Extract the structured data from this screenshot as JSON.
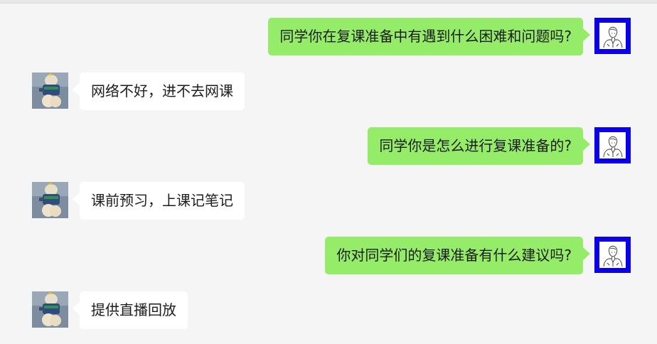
{
  "chat": {
    "messages": [
      {
        "sender": "teacher",
        "text": "同学你在复课准备中有遇到什么困难和问题吗?"
      },
      {
        "sender": "student",
        "text": "网络不好，进不去网课"
      },
      {
        "sender": "teacher",
        "text": "同学你是怎么进行复课准备的?"
      },
      {
        "sender": "student",
        "text": "课前预习，上课记笔记"
      },
      {
        "sender": "teacher",
        "text": "你对同学们的复课准备有什么建议吗?"
      },
      {
        "sender": "student",
        "text": "提供直播回放"
      }
    ]
  },
  "colors": {
    "background": "#f5f5f5",
    "sent_bubble": "#95ec69",
    "received_bubble": "#ffffff",
    "teacher_avatar_frame": "#0a00ea"
  },
  "icons": {
    "teacher_avatar": "line-drawing-person-avatar",
    "student_avatar": "toy-figure-photo-avatar"
  }
}
